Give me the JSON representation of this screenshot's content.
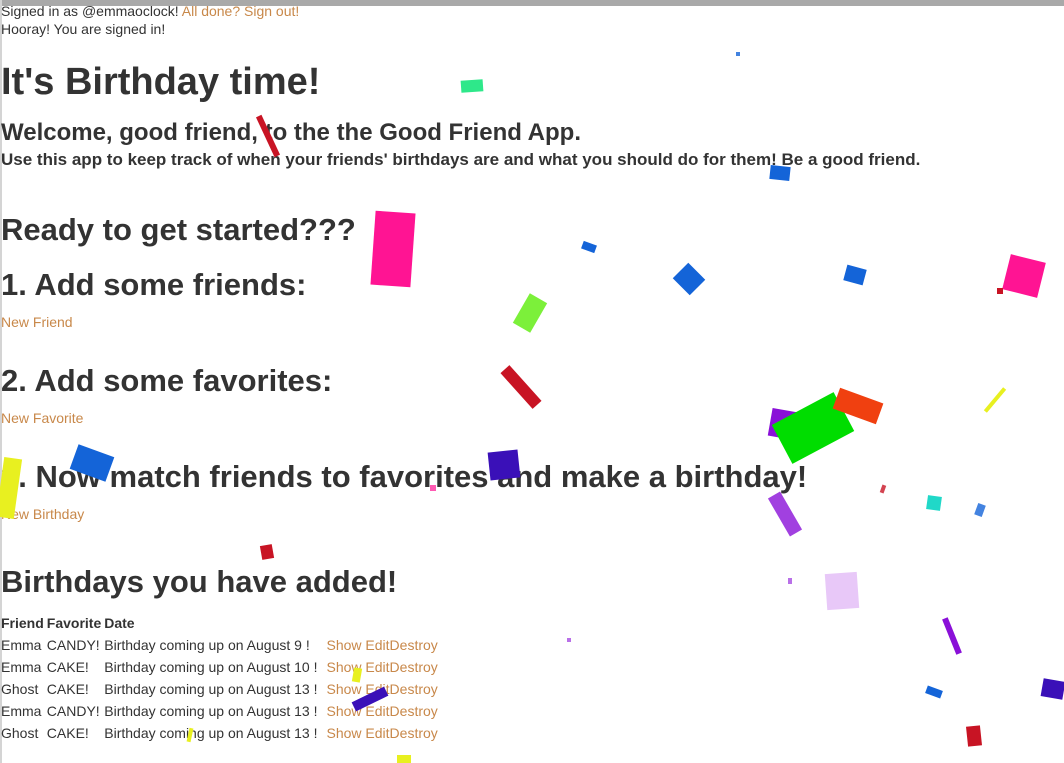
{
  "session": {
    "signed_in_text": "Signed in as @emmaoclock!",
    "sign_out_link": "All done? Sign out!",
    "flash": "Hooray! You are signed in!"
  },
  "page": {
    "title": "It's Birthday time!",
    "welcome": "Welcome, good friend, to the the Good Friend App.",
    "intro": "Use this app to keep track of when your friends' birthdays are and what you should do for them! Be a good friend."
  },
  "steps": {
    "ready": "Ready to get started???",
    "step1_heading": "1. Add some friends:",
    "step1_link": "New Friend",
    "step2_heading": "2. Add some favorites:",
    "step2_link": "New Favorite",
    "step3_heading": "3. Now match friends to favorites and make a birthday!",
    "step3_link": "New Birthday"
  },
  "birthdays": {
    "heading": "Birthdays you have added!",
    "columns": [
      "Friend",
      "Favorite",
      "Date"
    ],
    "rows": [
      {
        "friend": "Emma",
        "favorite": "CANDY!",
        "date": "Birthday coming up on August 9 !",
        "show": "Show",
        "edit": "Edit",
        "destroy": "Destroy"
      },
      {
        "friend": "Emma",
        "favorite": "CAKE!",
        "date": "Birthday coming up on August 10 !",
        "show": "Show",
        "edit": "Edit",
        "destroy": "Destroy"
      },
      {
        "friend": "Ghost",
        "favorite": "CAKE!",
        "date": "Birthday coming up on August 13 !",
        "show": "Show",
        "edit": "Edit",
        "destroy": "Destroy"
      },
      {
        "friend": "Emma",
        "favorite": "CANDY!",
        "date": "Birthday coming up on August 13 !",
        "show": "Show",
        "edit": "Edit",
        "destroy": "Destroy"
      },
      {
        "friend": "Ghost",
        "favorite": "CAKE!",
        "date": "Birthday coming up on August 13 !",
        "show": "Show",
        "edit": "Edit",
        "destroy": "Destroy"
      }
    ]
  },
  "colors": {
    "link": "#c8884a",
    "text": "#333333",
    "confetti": [
      "#ff1493",
      "#2ee88a",
      "#1464d8",
      "#7cf03a",
      "#c81424",
      "#00dd00",
      "#f04010",
      "#8a10d8",
      "#e8f020",
      "#3a10b8",
      "#20d8c8",
      "#e8c8f8"
    ]
  }
}
